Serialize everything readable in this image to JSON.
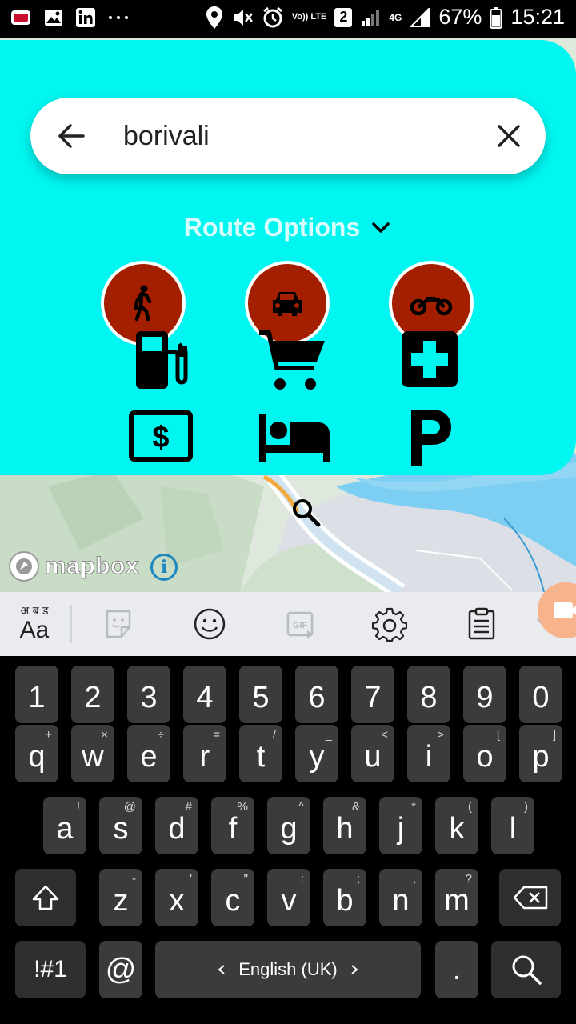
{
  "status_bar": {
    "battery": "67%",
    "time": "15:21",
    "network": "4G",
    "volte": "Vo)) LTE",
    "sim_slot": "2",
    "icons": [
      "notification-badge-icon",
      "gallery-icon",
      "linkedin-icon",
      "more-dots-icon",
      "location-icon",
      "mute-icon",
      "alarm-icon",
      "signal-icon",
      "battery-icon"
    ]
  },
  "search": {
    "query": "borivali",
    "back_icon": "arrow-left-icon",
    "clear_icon": "close-icon"
  },
  "route": {
    "title": "Route Options",
    "modes": [
      "walking",
      "car",
      "motorcycle"
    ]
  },
  "poi_categories": [
    "fuel",
    "shopping-cart",
    "hospital",
    "atm",
    "hotel",
    "parking"
  ],
  "map": {
    "attribution": "mapbox",
    "info_label": "i"
  },
  "keyboard_toolbar": {
    "lang_small": "अ ब ड",
    "lang_big": "Aa",
    "items": [
      "sticker",
      "emoji",
      "gif",
      "settings",
      "clipboard"
    ]
  },
  "keyboard": {
    "numbers": [
      "1",
      "2",
      "3",
      "4",
      "5",
      "6",
      "7",
      "8",
      "9",
      "0"
    ],
    "row1": [
      {
        "k": "q",
        "s": "+"
      },
      {
        "k": "w",
        "s": "×"
      },
      {
        "k": "e",
        "s": "÷"
      },
      {
        "k": "r",
        "s": "="
      },
      {
        "k": "t",
        "s": "/"
      },
      {
        "k": "y",
        "s": "_"
      },
      {
        "k": "u",
        "s": "<"
      },
      {
        "k": "i",
        "s": ">"
      },
      {
        "k": "o",
        "s": "["
      },
      {
        "k": "p",
        "s": "]"
      }
    ],
    "row2": [
      {
        "k": "a",
        "s": "!"
      },
      {
        "k": "s",
        "s": "@"
      },
      {
        "k": "d",
        "s": "#"
      },
      {
        "k": "f",
        "s": "%"
      },
      {
        "k": "g",
        "s": "^"
      },
      {
        "k": "h",
        "s": "&"
      },
      {
        "k": "j",
        "s": "*"
      },
      {
        "k": "k",
        "s": "("
      },
      {
        "k": "l",
        "s": ")"
      }
    ],
    "row3": [
      {
        "k": "z",
        "s": "-"
      },
      {
        "k": "x",
        "s": "'"
      },
      {
        "k": "c",
        "s": "\""
      },
      {
        "k": "v",
        "s": ":"
      },
      {
        "k": "b",
        "s": ";"
      },
      {
        "k": "n",
        "s": ","
      },
      {
        "k": "m",
        "s": "?"
      }
    ],
    "symbols_key": "!#1",
    "at_key": "@",
    "space_label": "English (UK)",
    "period_key": "."
  },
  "colors": {
    "panel": "#00f6f1",
    "mode_button": "#a31f00",
    "key": "#3b3b3b"
  }
}
